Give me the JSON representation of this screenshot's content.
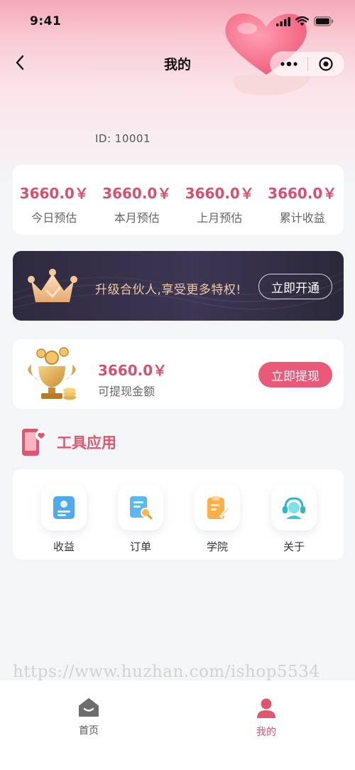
{
  "status_bar": {
    "time": "9:41"
  },
  "nav": {
    "title": "我的"
  },
  "user": {
    "id_text": "ID: 10001"
  },
  "stats": [
    {
      "value": "3660.0￥",
      "label": "今日预估"
    },
    {
      "value": "3660.0￥",
      "label": "本月预估"
    },
    {
      "value": "3660.0￥",
      "label": "上月预估"
    },
    {
      "value": "3660.0￥",
      "label": "累计收益"
    }
  ],
  "promo": {
    "text": "升级合伙人,享受更多特权!",
    "button_label": "立即开通"
  },
  "withdraw": {
    "amount": "3660.0￥",
    "label": "可提现金额",
    "button_label": "立即提现"
  },
  "tools": {
    "section_title": "工具应用",
    "items": [
      {
        "label": "收益",
        "icon": "earnings-icon"
      },
      {
        "label": "订单",
        "icon": "order-search-icon"
      },
      {
        "label": "学院",
        "icon": "clipboard-pen-icon"
      },
      {
        "label": "关于",
        "icon": "support-headset-icon"
      }
    ]
  },
  "watermark": "https://www.huzhan.com/ishop5534",
  "tab_bar": {
    "items": [
      {
        "label": "首页",
        "icon": "home-icon",
        "active": false
      },
      {
        "label": "我的",
        "icon": "profile-icon",
        "active": true
      }
    ]
  },
  "colors": {
    "accent": "#e0566f",
    "price": "#d94f6c",
    "promo_bg": "#2e2a3e",
    "promo_text": "#f0c9a3"
  }
}
